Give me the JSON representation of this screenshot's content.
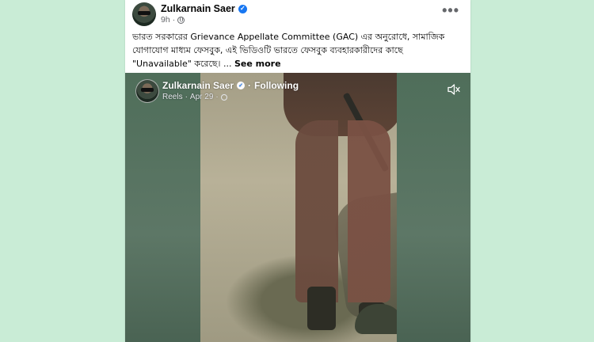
{
  "post": {
    "author": "Zulkarnain Saer",
    "time": "9h",
    "separator": "·",
    "text": "ভারত সরকারের Grievance Appellate Committee (GAC) এর অনুরোধে, সামাজিক যোগাযোগ মাধ্যম ফেসবুক, এই ভিডিওটি ভারতে ফেসবুক ব্যবহারকারীদের কাছে \"Unavailable\" করেছে। ...",
    "see_more": "See more",
    "menu_label": "•••"
  },
  "reel": {
    "author": "Zulkarnain Saer",
    "follow_sep": "·",
    "following": "Following",
    "source": "Reels",
    "separator": "·",
    "date": "Apr 29",
    "separator2": "·"
  },
  "icons": {
    "verified": "verified-badge-icon",
    "globe": "globe-icon",
    "menu": "more-options-icon",
    "mute": "speaker-muted-icon"
  },
  "colors": {
    "background": "#c9ecd6",
    "card": "#ffffff",
    "verified": "#1877f2",
    "meta_text": "#65676b"
  }
}
